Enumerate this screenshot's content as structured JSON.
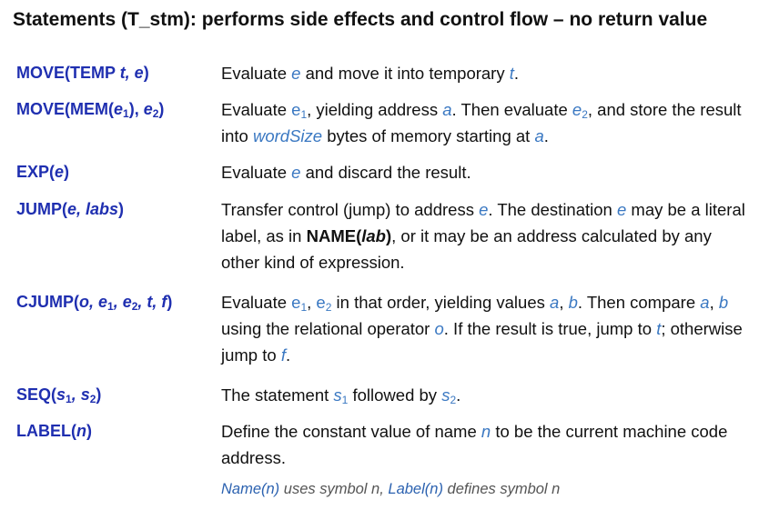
{
  "title": "Statements (T_stm): performs side effects and control flow – no return value",
  "rows": [
    {
      "syntax": {
        "a": "MOVE(TEMP ",
        "b": "t, e",
        "c": ")"
      },
      "desc": {
        "a": "Evaluate ",
        "b": "e",
        "c": " and move it into temporary ",
        "d": "t",
        "e": "."
      }
    },
    {
      "syntax": {
        "a": "MOVE(MEM(",
        "b": "e",
        "b_sub": "1",
        "c": "), ",
        "d": "e",
        "d_sub": "2",
        "e": ")"
      },
      "desc": {
        "a": "Evaluate ",
        "b": "e",
        "b_sub": "1",
        "c": ", yielding address ",
        "d": "a",
        "e": ". Then evaluate ",
        "f": "e",
        "f_sub": "2",
        "g": ", and store the result into ",
        "h": "wordSize",
        "i": " bytes of memory starting at ",
        "j": "a",
        "k": "."
      }
    },
    {
      "syntax": {
        "a": "EXP(",
        "b": "e",
        "c": ")"
      },
      "desc": {
        "a": "Evaluate ",
        "b": "e",
        "c": " and discard the result."
      }
    },
    {
      "syntax": {
        "a": "JUMP(",
        "b": "e, labs",
        "c": ")"
      },
      "desc": {
        "a": "Transfer control (jump) to address ",
        "b": "e",
        "c": ". The destination ",
        "d": "e",
        "e": " may be a literal label, as in ",
        "f": "NAME(",
        "g": "lab",
        "h": ")",
        "i": ", or it may be an address calculated by any other kind of expression."
      }
    },
    {
      "syntax": {
        "a": "CJUMP(",
        "b": "o, e",
        "b_sub": "1",
        "c": ", e",
        "c_sub": "2",
        "d": ", t, f",
        "e": ")"
      },
      "desc": {
        "a": "Evaluate ",
        "b": "e",
        "b_sub": "1",
        "c": ", ",
        "d": "e",
        "d_sub": "2",
        "e": " in that order, yielding values ",
        "f": "a",
        "g": ", ",
        "h": "b",
        "i": ". Then compare ",
        "j": "a",
        "k": ", ",
        "l": "b",
        "m": " using the relational operator ",
        "n": "o",
        "o": ". If the result is true, jump to ",
        "p": "t",
        "q": "; otherwise jump to ",
        "r": "f",
        "s": "."
      }
    },
    {
      "syntax": {
        "a": "SEQ(",
        "b": "s",
        "b_sub": "1",
        "c": ", s",
        "c_sub": "2",
        "d": ")"
      },
      "desc": {
        "a": "The statement ",
        "b": "s",
        "b_sub": "1",
        "c": " followed by ",
        "d": "s",
        "d_sub": "2",
        "e": "."
      }
    },
    {
      "syntax": {
        "a": "LABEL(",
        "b": "n",
        "c": ")"
      },
      "desc": {
        "a": "Define the constant value of name ",
        "b": "n",
        "c": " to be the current machine code address."
      }
    }
  ],
  "footnote": {
    "a": "Name(n)",
    "b": " uses symbol n, ",
    "c": "Label(n)",
    "d": " defines symbol n"
  },
  "colors": {
    "syntax": "#1f2fb0",
    "variable": "#3a78c2",
    "text": "#111111",
    "footnote": "#555555"
  }
}
